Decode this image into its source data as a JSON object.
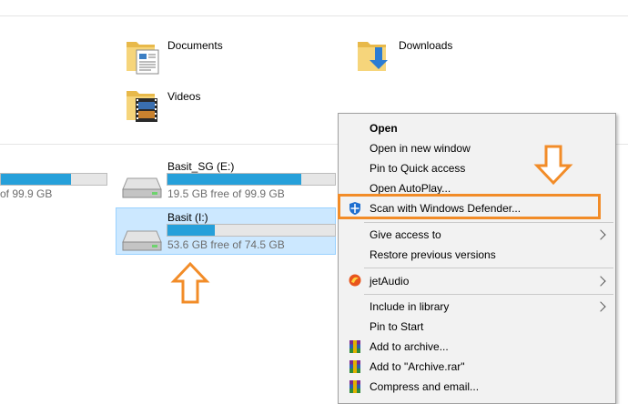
{
  "folders": [
    {
      "name": "Documents",
      "icon": "documents-folder-icon"
    },
    {
      "name": "Downloads",
      "icon": "downloads-folder-icon"
    },
    {
      "name": "Videos",
      "icon": "videos-folder-icon"
    }
  ],
  "drives": [
    {
      "name": "",
      "free": "of 99.9 GB",
      "used_fraction": 0.66
    },
    {
      "name": "Basit_SG (E:)",
      "free": "19.5 GB free of 99.9 GB",
      "used_fraction": 0.8
    },
    {
      "name": "Basit (I:)",
      "free": "53.6 GB free of 74.5 GB",
      "used_fraction": 0.28
    }
  ],
  "context_menu": {
    "items": [
      {
        "label": "Open"
      },
      {
        "label": "Open in new window"
      },
      {
        "label": "Pin to Quick access"
      },
      {
        "label": "Open AutoPlay..."
      },
      {
        "label": "Scan with Windows Defender..."
      },
      {
        "label": "Give access to"
      },
      {
        "label": "Restore previous versions"
      },
      {
        "label": "jetAudio"
      },
      {
        "label": "Include in library"
      },
      {
        "label": "Pin to Start"
      },
      {
        "label": "Add to archive..."
      },
      {
        "label": "Add to \"Archive.rar\""
      },
      {
        "label": "Compress and email..."
      }
    ]
  },
  "colors": {
    "accent": "#26a0da",
    "annotation": "#f28c28",
    "selection": "#cce8ff"
  }
}
